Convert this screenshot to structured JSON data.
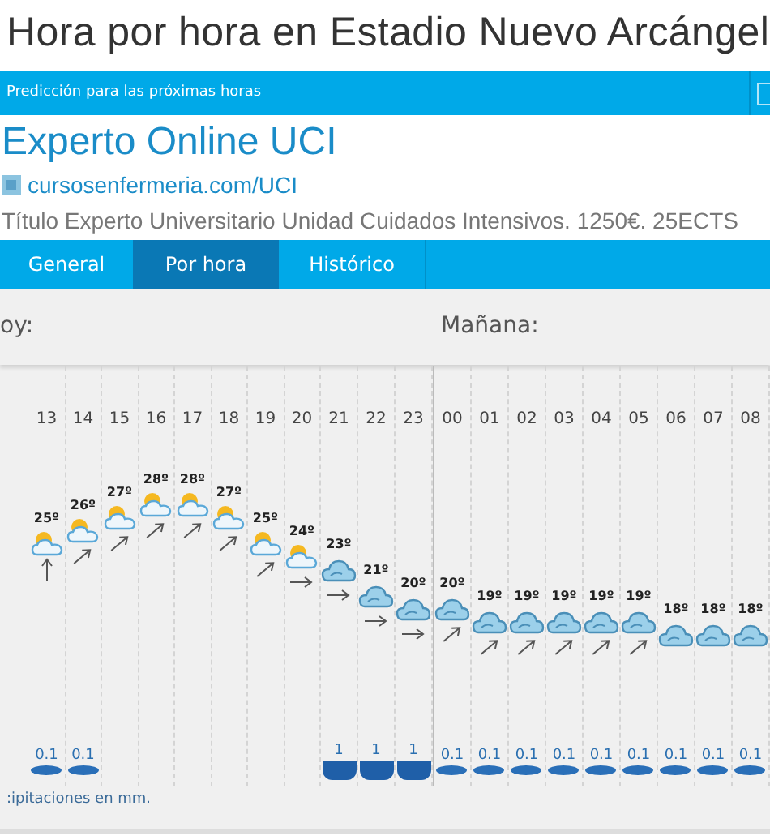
{
  "title": "Hora por hora en Estadio Nuevo Arcángel",
  "banner": {
    "text": "Predicción para las próximas horas"
  },
  "ad": {
    "headline": "Experto Online UCI",
    "url": "cursosenfermeria.com/UCI",
    "description": "Título Experto Universitario Unidad Cuidados Intensivos. 1250€. 25ECTS"
  },
  "tabs": [
    {
      "label": "General",
      "selected": false
    },
    {
      "label": "Por hora",
      "selected": true
    },
    {
      "label": "Histórico",
      "selected": false
    }
  ],
  "days": [
    {
      "label": "oy:"
    },
    {
      "label": "Mañana:"
    }
  ],
  "hours": [
    {
      "hour": "13",
      "temp": "25º",
      "sky": {
        "kind": "partly_cloudy"
      },
      "wind": {
        "kind": "north"
      },
      "precip": {
        "amount": "0.1",
        "kind": "light"
      }
    },
    {
      "hour": "14",
      "temp": "26º",
      "sky": {
        "kind": "partly_cloudy"
      },
      "wind": {
        "kind": "northeast"
      },
      "precip": {
        "amount": "0.1",
        "kind": "light"
      }
    },
    {
      "hour": "15",
      "temp": "27º",
      "sky": {
        "kind": "partly_cloudy"
      },
      "wind": {
        "kind": "northeast"
      }
    },
    {
      "hour": "16",
      "temp": "28º",
      "sky": {
        "kind": "partly_cloudy"
      },
      "wind": {
        "kind": "northeast"
      }
    },
    {
      "hour": "17",
      "temp": "28º",
      "sky": {
        "kind": "partly_cloudy"
      },
      "wind": {
        "kind": "northeast"
      }
    },
    {
      "hour": "18",
      "temp": "27º",
      "sky": {
        "kind": "partly_cloudy"
      },
      "wind": {
        "kind": "northeast"
      }
    },
    {
      "hour": "19",
      "temp": "25º",
      "sky": {
        "kind": "partly_cloudy"
      },
      "wind": {
        "kind": "northeast"
      }
    },
    {
      "hour": "20",
      "temp": "24º",
      "sky": {
        "kind": "partly_cloudy"
      },
      "wind": {
        "kind": "east"
      }
    },
    {
      "hour": "21",
      "temp": "23º",
      "sky": {
        "kind": "cloudy"
      },
      "wind": {
        "kind": "east"
      },
      "precip": {
        "amount": "1",
        "kind": "heavy"
      }
    },
    {
      "hour": "22",
      "temp": "21º",
      "sky": {
        "kind": "cloudy"
      },
      "wind": {
        "kind": "east"
      },
      "precip": {
        "amount": "1",
        "kind": "heavy"
      }
    },
    {
      "hour": "23",
      "temp": "20º",
      "sky": {
        "kind": "cloudy"
      },
      "wind": {
        "kind": "east"
      },
      "precip": {
        "amount": "1",
        "kind": "heavy"
      }
    },
    {
      "hour": "00",
      "temp": "20º",
      "sky": {
        "kind": "cloudy"
      },
      "wind": {
        "kind": "northeast"
      },
      "precip": {
        "amount": "0.1",
        "kind": "light"
      },
      "new_day": true
    },
    {
      "hour": "01",
      "temp": "19º",
      "sky": {
        "kind": "cloudy"
      },
      "wind": {
        "kind": "northeast"
      },
      "precip": {
        "amount": "0.1",
        "kind": "light"
      }
    },
    {
      "hour": "02",
      "temp": "19º",
      "sky": {
        "kind": "cloudy"
      },
      "wind": {
        "kind": "northeast"
      },
      "precip": {
        "amount": "0.1",
        "kind": "light"
      }
    },
    {
      "hour": "03",
      "temp": "19º",
      "sky": {
        "kind": "cloudy"
      },
      "wind": {
        "kind": "northeast"
      },
      "precip": {
        "amount": "0.1",
        "kind": "light"
      }
    },
    {
      "hour": "04",
      "temp": "19º",
      "sky": {
        "kind": "cloudy"
      },
      "wind": {
        "kind": "northeast"
      },
      "precip": {
        "amount": "0.1",
        "kind": "light"
      }
    },
    {
      "hour": "05",
      "temp": "19º",
      "sky": {
        "kind": "cloudy"
      },
      "wind": {
        "kind": "northeast"
      },
      "precip": {
        "amount": "0.1",
        "kind": "light"
      }
    },
    {
      "hour": "06",
      "temp": "18º",
      "sky": {
        "kind": "cloudy"
      },
      "precip": {
        "amount": "0.1",
        "kind": "light"
      }
    },
    {
      "hour": "07",
      "temp": "18º",
      "sky": {
        "kind": "cloudy"
      },
      "precip": {
        "amount": "0.1",
        "kind": "light"
      }
    },
    {
      "hour": "08",
      "temp": "18º",
      "sky": {
        "kind": "cloudy"
      },
      "precip": {
        "amount": "0.1",
        "kind": "light"
      }
    }
  ],
  "precip_note": ":ipitaciones en mm."
}
